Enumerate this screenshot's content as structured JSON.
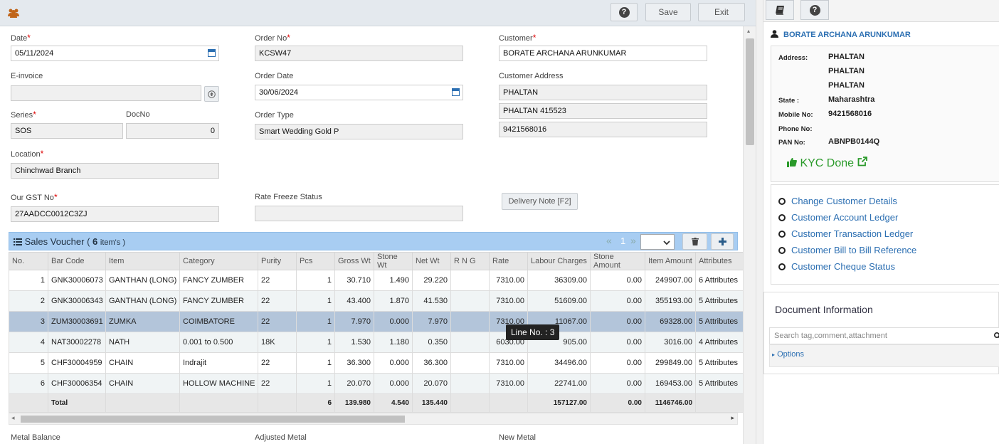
{
  "toolbar": {
    "save_label": "Save",
    "exit_label": "Exit",
    "help_glyph": "?"
  },
  "form": {
    "date": {
      "label": "Date",
      "value": "05/11/2024"
    },
    "order_no": {
      "label": "Order No",
      "value": "KCSW47"
    },
    "customer": {
      "label": "Customer",
      "value": "BORATE ARCHANA ARUNKUMAR"
    },
    "einvoice": {
      "label": "E-invoice",
      "value": ""
    },
    "order_date": {
      "label": "Order Date",
      "value": "30/06/2024"
    },
    "customer_address": {
      "label": "Customer Address",
      "line1": "PHALTAN",
      "line2": "PHALTAN 415523",
      "line3": "9421568016"
    },
    "series": {
      "label": "Series",
      "value": "SOS"
    },
    "docno": {
      "label": "DocNo",
      "value": "0"
    },
    "order_type": {
      "label": "Order Type",
      "value": "Smart Wedding Gold P"
    },
    "location": {
      "label": "Location",
      "value": "Chinchwad Branch"
    },
    "gst": {
      "label": "Our GST No",
      "value": "27AADCC0012C3ZJ"
    },
    "rate_freeze": {
      "label": "Rate Freeze Status",
      "value": ""
    },
    "delivery_note_label": "Delivery Note [F2]",
    "metal_balance_label": "Metal Balance",
    "adjusted_metal_label": "Adjusted Metal",
    "new_metal_label": "New Metal"
  },
  "voucher": {
    "title": "Sales Voucher (",
    "count": "6",
    "items_suffix": "item's )",
    "pager_prev": "«",
    "pager_page": "1",
    "pager_next": "»",
    "columns": [
      "No.",
      "Bar Code",
      "Item",
      "Category",
      "Purity",
      "Pcs",
      "Gross Wt",
      "Stone Wt",
      "Net Wt",
      "R N G",
      "Rate",
      "Labour Charges",
      "Stone Amount",
      "Item Amount",
      "Attributes"
    ],
    "rows": [
      [
        "1",
        "GNK30006073",
        "GANTHAN (LONG)",
        "FANCY ZUMBER",
        "22",
        "1",
        "30.710",
        "1.490",
        "29.220",
        "",
        "7310.00",
        "36309.00",
        "0.00",
        "249907.00",
        "6 Attributes"
      ],
      [
        "2",
        "GNK30006343",
        "GANTHAN (LONG)",
        "FANCY ZUMBER",
        "22",
        "1",
        "43.400",
        "1.870",
        "41.530",
        "",
        "7310.00",
        "51609.00",
        "0.00",
        "355193.00",
        "5 Attributes"
      ],
      [
        "3",
        "ZUM30003691",
        "ZUMKA",
        "COIMBATORE",
        "22",
        "1",
        "7.970",
        "0.000",
        "7.970",
        "",
        "7310.00",
        "11067.00",
        "0.00",
        "69328.00",
        "5 Attributes"
      ],
      [
        "4",
        "NAT30002278",
        "NATH",
        "0.001 to 0.500",
        "18K",
        "1",
        "1.530",
        "1.180",
        "0.350",
        "",
        "6030.00",
        "905.00",
        "0.00",
        "3016.00",
        "4 Attributes"
      ],
      [
        "5",
        "CHF30004959",
        "CHAIN",
        "Indrajit",
        "22",
        "1",
        "36.300",
        "0.000",
        "36.300",
        "",
        "7310.00",
        "34496.00",
        "0.00",
        "299849.00",
        "5 Attributes"
      ],
      [
        "6",
        "CHF30006354",
        "CHAIN",
        "HOLLOW MACHINE",
        "22",
        "1",
        "20.070",
        "0.000",
        "20.070",
        "",
        "7310.00",
        "22741.00",
        "0.00",
        "169453.00",
        "5 Attributes"
      ]
    ],
    "total": [
      "",
      "Total",
      "",
      "",
      "",
      "6",
      "139.980",
      "4.540",
      "135.440",
      "",
      "",
      "157127.00",
      "0.00",
      "1146746.00",
      ""
    ],
    "tooltip": "Line No. : 3"
  },
  "customer_panel": {
    "name": "BORATE ARCHANA ARUNKUMAR",
    "address_label": "Address:",
    "address": [
      "PHALTAN",
      "PHALTAN",
      "PHALTAN"
    ],
    "state_label": "State :",
    "state": "Maharashtra",
    "mobile_label": "Mobile No:",
    "mobile": "9421568016",
    "phone_label": "Phone No:",
    "phone": "",
    "pan_label": "PAN No:",
    "pan": "ABNPB0144Q",
    "kyc": "KYC Done",
    "links": [
      "Change Customer Details",
      "Customer Account Ledger",
      "Customer Transaction Ledger",
      "Customer Bill to Bill Reference",
      "Customer Cheque Status"
    ]
  },
  "document_info": {
    "title": "Document Information",
    "search_placeholder": "Search tag,comment,attachment",
    "options_label": "Options"
  },
  "colors": {
    "accent": "#2c6fb2",
    "header_bar": "#a8cdf2",
    "selected_row": "#b3c5da",
    "kyc": "#2a9a2a",
    "required": "#dd0000"
  },
  "icons": [
    "users-icon",
    "help-icon",
    "book-icon",
    "calendar-icon",
    "upload-icon",
    "list-icon",
    "trash-icon",
    "plus-icon",
    "user-icon",
    "thumbs-up-icon",
    "external-link-icon",
    "search-icon"
  ]
}
